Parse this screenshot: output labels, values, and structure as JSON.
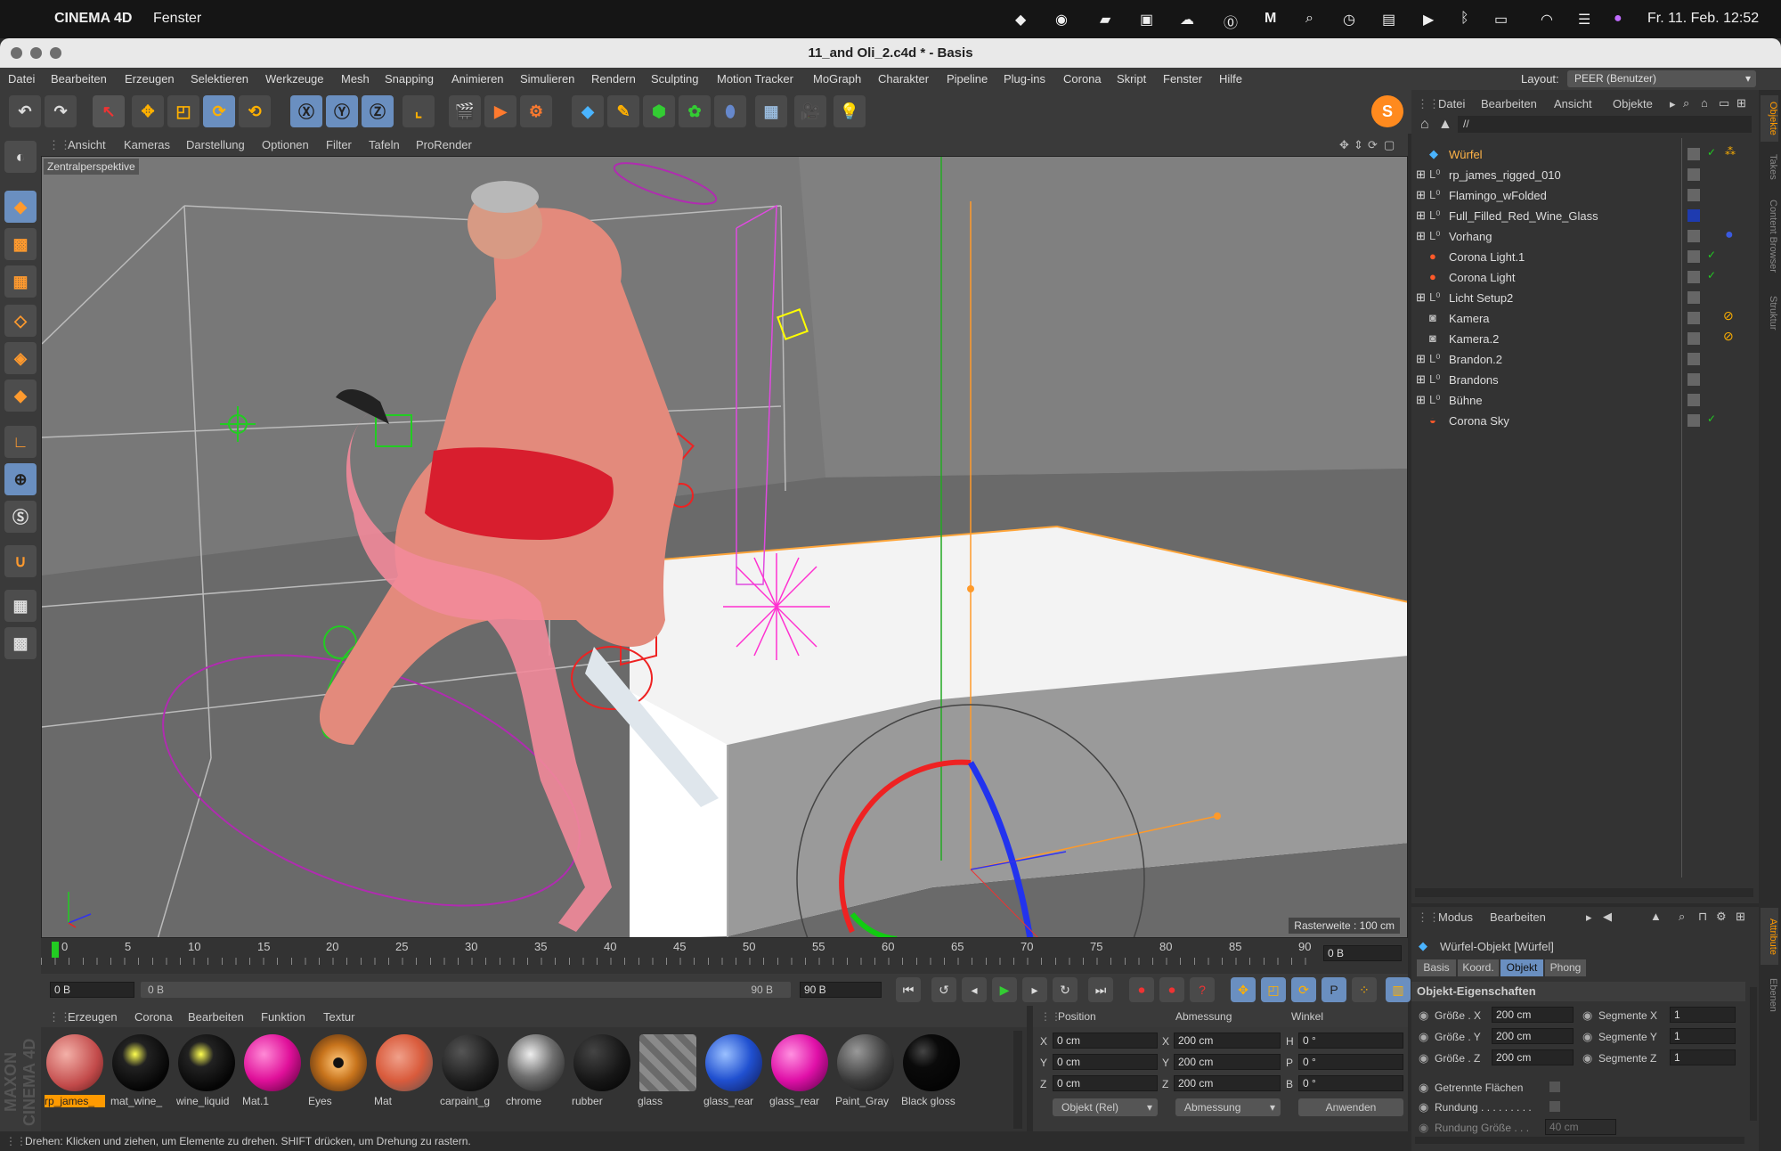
{
  "mac": {
    "app": "CINEMA 4D",
    "menu": "Fenster",
    "clock": "Fr. 11. Feb.  12:52"
  },
  "window": {
    "title": "11_and Oli_2.c4d * - Basis"
  },
  "menu": [
    "Datei",
    "Bearbeiten",
    "Erzeugen",
    "Selektieren",
    "Werkzeuge",
    "Mesh",
    "Snapping",
    "Animieren",
    "Simulieren",
    "Rendern",
    "Sculpting",
    "Motion Tracker",
    "MoGraph",
    "Charakter",
    "Pipeline",
    "Plug-ins",
    "Corona",
    "Skript",
    "Fenster",
    "Hilfe"
  ],
  "layout": {
    "label": "Layout:",
    "value": "PEER (Benutzer)"
  },
  "viewport": {
    "menu": [
      "Ansicht",
      "Kameras",
      "Darstellung",
      "Optionen",
      "Filter",
      "Tafeln",
      "ProRender"
    ],
    "camera": "Zentralperspektive",
    "grid": "Rasterweite : 100 cm"
  },
  "timeline": {
    "ticks": [
      "0",
      "5",
      "10",
      "15",
      "20",
      "25",
      "30",
      "35",
      "40",
      "45",
      "50",
      "55",
      "60",
      "65",
      "70",
      "75",
      "80",
      "85",
      "90"
    ],
    "current": "0 B",
    "start": "0 B",
    "range_start": "0 B",
    "range_end": "90 B",
    "end": "90 B"
  },
  "objects": {
    "menu": [
      "Datei",
      "Bearbeiten",
      "Ansicht",
      "Objekte"
    ],
    "path": "//",
    "items": [
      {
        "name": "Würfel",
        "color": "#ffb347"
      },
      {
        "name": "rp_james_rigged_010",
        "color": "#ddd"
      },
      {
        "name": "Flamingo_wFolded",
        "color": "#ddd"
      },
      {
        "name": "Full_Filled_Red_Wine_Glass",
        "color": "#ddd"
      },
      {
        "name": "Vorhang",
        "color": "#ddd"
      },
      {
        "name": "Corona Light.1",
        "color": "#ddd"
      },
      {
        "name": "Corona Light",
        "color": "#ddd"
      },
      {
        "name": "Licht Setup2",
        "color": "#ddd"
      },
      {
        "name": "Kamera",
        "color": "#ddd"
      },
      {
        "name": "Kamera.2",
        "color": "#ddd"
      },
      {
        "name": "Brandon.2",
        "color": "#ddd"
      },
      {
        "name": "Brandons",
        "color": "#ddd"
      },
      {
        "name": "Bühne",
        "color": "#ddd"
      },
      {
        "name": "Corona Sky",
        "color": "#ddd"
      }
    ]
  },
  "side_tabs": {
    "top": [
      "Objekte",
      "Takes",
      "Content Browser",
      "Struktur"
    ],
    "bottom": [
      "Attribute",
      "Ebenen"
    ]
  },
  "attributes": {
    "menu": [
      "Modus",
      "Bearbeiten"
    ],
    "title": "Würfel-Objekt [Würfel]",
    "tabs": [
      "Basis",
      "Koord.",
      "Objekt",
      "Phong"
    ],
    "section": "Objekt-Eigenschaften",
    "rows": [
      {
        "label": "Größe . X",
        "value": "200 cm",
        "seg_label": "Segmente X",
        "seg_value": "1"
      },
      {
        "label": "Größe . Y",
        "value": "200 cm",
        "seg_label": "Segmente Y",
        "seg_value": "1"
      },
      {
        "label": "Größe . Z",
        "value": "200 cm",
        "seg_label": "Segmente Z",
        "seg_value": "1"
      }
    ],
    "flags": [
      "Getrennte Flächen",
      "Rundung . . . . . . . . ."
    ],
    "rounding_label": "Rundung Größe . . .",
    "rounding_value": "40 cm"
  },
  "materials": {
    "menu": [
      "Erzeugen",
      "Corona",
      "Bearbeiten",
      "Funktion",
      "Textur"
    ],
    "items": [
      {
        "name": "rp_james_",
        "color": "#c24a4a"
      },
      {
        "name": "mat_wine_",
        "color": "#1b1b10"
      },
      {
        "name": "wine_liquid",
        "color": "#1b1b10"
      },
      {
        "name": "Mat.1",
        "color": "#e0109a"
      },
      {
        "name": "Eyes",
        "color": "#c8741c"
      },
      {
        "name": "Mat",
        "color": "#d95b3c"
      },
      {
        "name": "carpaint_g",
        "color": "#1e1e1e"
      },
      {
        "name": "chrome",
        "color": "#707070"
      },
      {
        "name": "rubber",
        "color": "#161616"
      },
      {
        "name": "glass",
        "color": "#8a8a8a"
      },
      {
        "name": "glass_rear",
        "color": "#2050d0"
      },
      {
        "name": "glass_rear",
        "color": "#e010a8"
      },
      {
        "name": "Paint_Gray",
        "color": "#3a3a3a"
      },
      {
        "name": "Black gloss",
        "color": "#0a0a0a"
      }
    ]
  },
  "coords": {
    "headers": [
      "Position",
      "Abmessung",
      "Winkel"
    ],
    "rows": [
      {
        "axis": "X",
        "pos": "0 cm",
        "dim_axis": "X",
        "dim": "200 cm",
        "ang_axis": "H",
        "ang": "0 °"
      },
      {
        "axis": "Y",
        "pos": "0 cm",
        "dim_axis": "Y",
        "dim": "200 cm",
        "ang_axis": "P",
        "ang": "0 °"
      },
      {
        "axis": "Z",
        "pos": "0 cm",
        "dim_axis": "Z",
        "dim": "200 cm",
        "ang_axis": "B",
        "ang": "0 °"
      }
    ],
    "mode1": "Objekt (Rel)",
    "mode2": "Abmessung",
    "apply": "Anwenden"
  },
  "status": "Drehen: Klicken und ziehen, um Elemente zu drehen. SHIFT drücken, um Drehung zu rastern.",
  "brand": "MAXON CINEMA 4D"
}
